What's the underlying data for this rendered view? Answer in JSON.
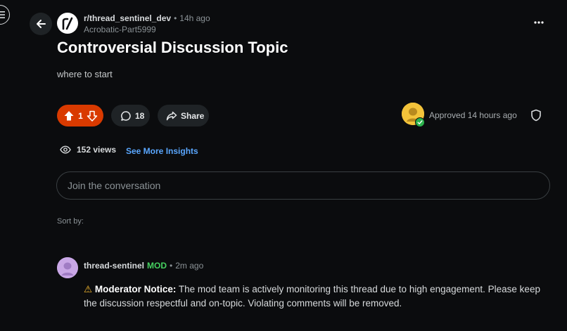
{
  "post": {
    "subreddit": "r/thread_sentinel_dev",
    "separator": "•",
    "age": "14h ago",
    "author": "Acrobatic-Part5999",
    "title": "Controversial Discussion Topic",
    "body": "where to start"
  },
  "actions": {
    "vote_count": "1",
    "comment_count": "18",
    "share_label": "Share"
  },
  "moderation": {
    "approved_label": "Approved 14 hours ago"
  },
  "insights": {
    "views": "152 views",
    "link": "See More Insights"
  },
  "composer": {
    "placeholder": "Join the conversation"
  },
  "sort": {
    "label": "Sort by:"
  },
  "comment": {
    "username": "thread-sentinel",
    "badge": "MOD",
    "separator": "•",
    "age": "2m ago",
    "warning_glyph": "⚠",
    "notice_heading": "Moderator Notice:",
    "notice_text": "The mod team is actively monitoring this thread due to high engagement. Please keep the discussion respectful and on-topic. Violating comments will be removed."
  },
  "colors": {
    "upvote_accent": "#d93a00",
    "link": "#5aa7ff",
    "mod_badge": "#46d160",
    "approved_check": "#2bb24c"
  },
  "icons": [
    "menu-icon",
    "back-arrow-icon",
    "subreddit-logo-icon",
    "more-options-icon",
    "upvote-icon",
    "downvote-icon",
    "comment-icon",
    "share-icon",
    "moderator-avatar-icon",
    "check-icon",
    "shield-icon",
    "eye-icon",
    "warning-icon"
  ]
}
